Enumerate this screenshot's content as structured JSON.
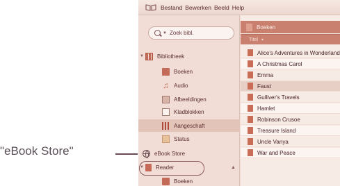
{
  "callout": {
    "text": "\"eBook Store\""
  },
  "menubar": {
    "items": [
      "Bestand",
      "Bewerken",
      "Beeld",
      "Help"
    ]
  },
  "sidebar": {
    "search_placeholder": "Zoek bibl.",
    "library_label": "Bibliotheek",
    "items": [
      {
        "label": "Boeken"
      },
      {
        "label": "Audio"
      },
      {
        "label": "Afbeeldingen"
      },
      {
        "label": "Kladblokken"
      },
      {
        "label": "Aangeschaft"
      },
      {
        "label": "Status"
      }
    ],
    "store_label": "eBook Store",
    "device_label": "Reader",
    "device_items": [
      {
        "label": "Boeken"
      }
    ]
  },
  "main": {
    "title": "Boeken",
    "column_header": "Titel",
    "rows": [
      "Alice's Adventures in Wonderland",
      "A Christmas Carol",
      "Emma",
      "Faust",
      "Gulliver's Travels",
      "Hamlet",
      "Robinson Crusoe",
      "Treasure Island",
      "Uncle Vanya",
      "War and Peace"
    ]
  },
  "colors": {
    "accent": "#c9806f",
    "selection": "#e3c4b9",
    "sidebar_bg": "#f1ddd6"
  }
}
